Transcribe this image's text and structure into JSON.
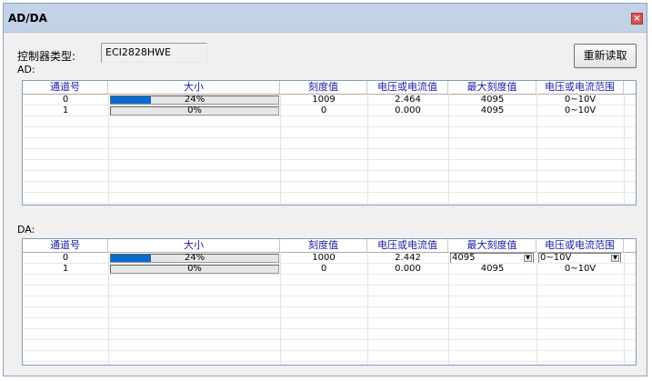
{
  "window": {
    "title": "AD/DA",
    "close_glyph": "×"
  },
  "controller": {
    "label": "控制器类型:",
    "value": "ECI2828HWE"
  },
  "reload_button": "重新读取",
  "ad": {
    "label": "AD:",
    "columns": [
      "通道号",
      "大小",
      "刻度值",
      "电压或电流值",
      "最大刻度值",
      "电压或电流范围"
    ],
    "rows": [
      {
        "channel": "0",
        "percent": 24,
        "percent_text": "24%",
        "scale": "1009",
        "voltage": "2.464",
        "max_scale": "4095",
        "range": "0~10V"
      },
      {
        "channel": "1",
        "percent": 0,
        "percent_text": "0%",
        "scale": "0",
        "voltage": "0.000",
        "max_scale": "4095",
        "range": "0~10V"
      }
    ]
  },
  "da": {
    "label": "DA:",
    "columns": [
      "通道号",
      "大小",
      "刻度值",
      "电压或电流值",
      "最大刻度值",
      "电压或电流范围"
    ],
    "rows": [
      {
        "channel": "0",
        "percent": 24,
        "percent_text": "24%",
        "scale": "1000",
        "voltage": "2.442",
        "max_scale": "4095",
        "range": "0~10V",
        "editable": true
      },
      {
        "channel": "1",
        "percent": 0,
        "percent_text": "0%",
        "scale": "0",
        "voltage": "0.000",
        "max_scale": "4095",
        "range": "0~10V",
        "editable": false
      }
    ]
  },
  "colors": {
    "header_text": "#1a1aa6",
    "progress_fill": "#0a6ad0",
    "titlebar": "#c3d2e6",
    "close": "#d9534f"
  },
  "icons": {
    "close": "close-icon",
    "dropdown": "chevron-down-icon"
  }
}
